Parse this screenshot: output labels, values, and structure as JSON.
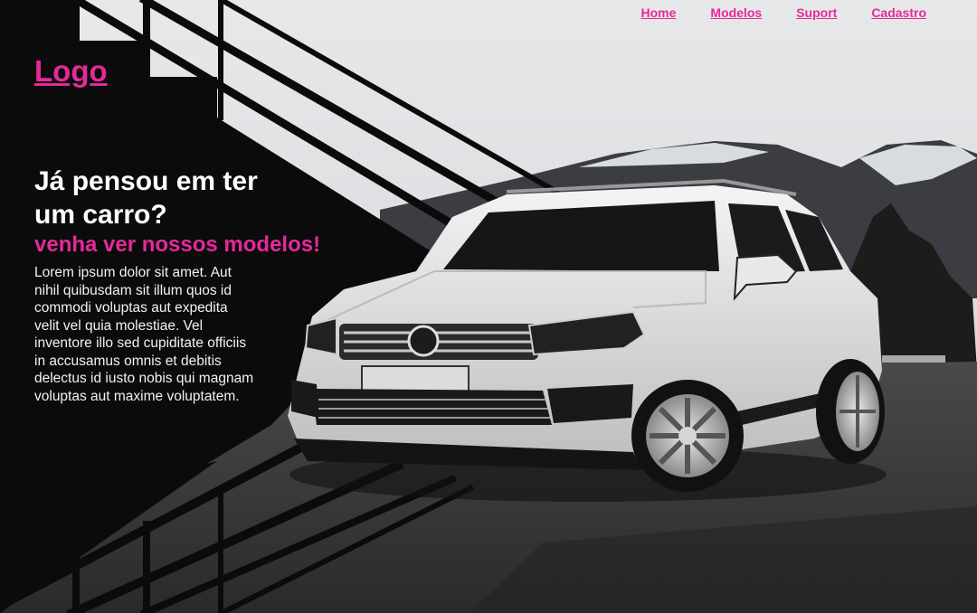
{
  "colors": {
    "accent": "#e6299a",
    "panel": "#0b0b0c",
    "heading": "#ffffff",
    "body_text": "#f2f2f2"
  },
  "nav": {
    "items": [
      {
        "label": "Home"
      },
      {
        "label": "Modelos"
      },
      {
        "label": "Suport"
      },
      {
        "label": "Cadastro"
      }
    ]
  },
  "logo": {
    "text": "Logo"
  },
  "hero": {
    "title": "Já pensou em ter um carro?",
    "subtitle": "venha ver nossos modelos!",
    "body": "Lorem ipsum dolor sit amet. Aut nihil quibusdam sit illum quos id commodi voluptas aut expedita velit vel quia molestiae. Vel inventore illo sed cupiditate officiis in accusamus omnis et debitis delectus id iusto nobis qui magnam voluptas aut maxime voluptatem."
  },
  "background": {
    "image_icon": "white-suv-photo"
  }
}
